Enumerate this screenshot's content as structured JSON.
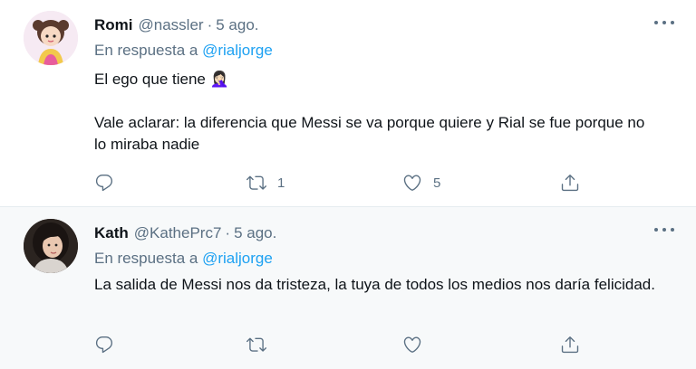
{
  "tweets": [
    {
      "name": "Romi",
      "handle": "@nassler",
      "separator": "·",
      "time": "5 ago.",
      "reply_prefix": "En respuesta a",
      "reply_to": "@rialjorge",
      "text_line1": "El ego que tiene 🤦🏻‍♀️",
      "text_line2": "Vale aclarar:  la diferencia que Messi se va porque quiere y Rial se fue porque no lo miraba nadie",
      "retweets": "1",
      "likes": "5"
    },
    {
      "name": "Kath",
      "handle": "@KathePrc7",
      "separator": "·",
      "time": "5 ago.",
      "reply_prefix": "En respuesta a",
      "reply_to": "@rialjorge",
      "text": "La salida de Messi nos da tristeza, la tuya de todos los medios nos daría felicidad.",
      "retweets": "",
      "likes": ""
    }
  ],
  "colors": {
    "text": "#0f1419",
    "secondary": "#5b7083",
    "link": "#1da1f2",
    "divider": "#e6ecf0",
    "hover_bg": "#f7f9fa"
  },
  "icons": [
    "reply-icon",
    "retweet-icon",
    "like-icon",
    "share-icon",
    "more-icon"
  ]
}
